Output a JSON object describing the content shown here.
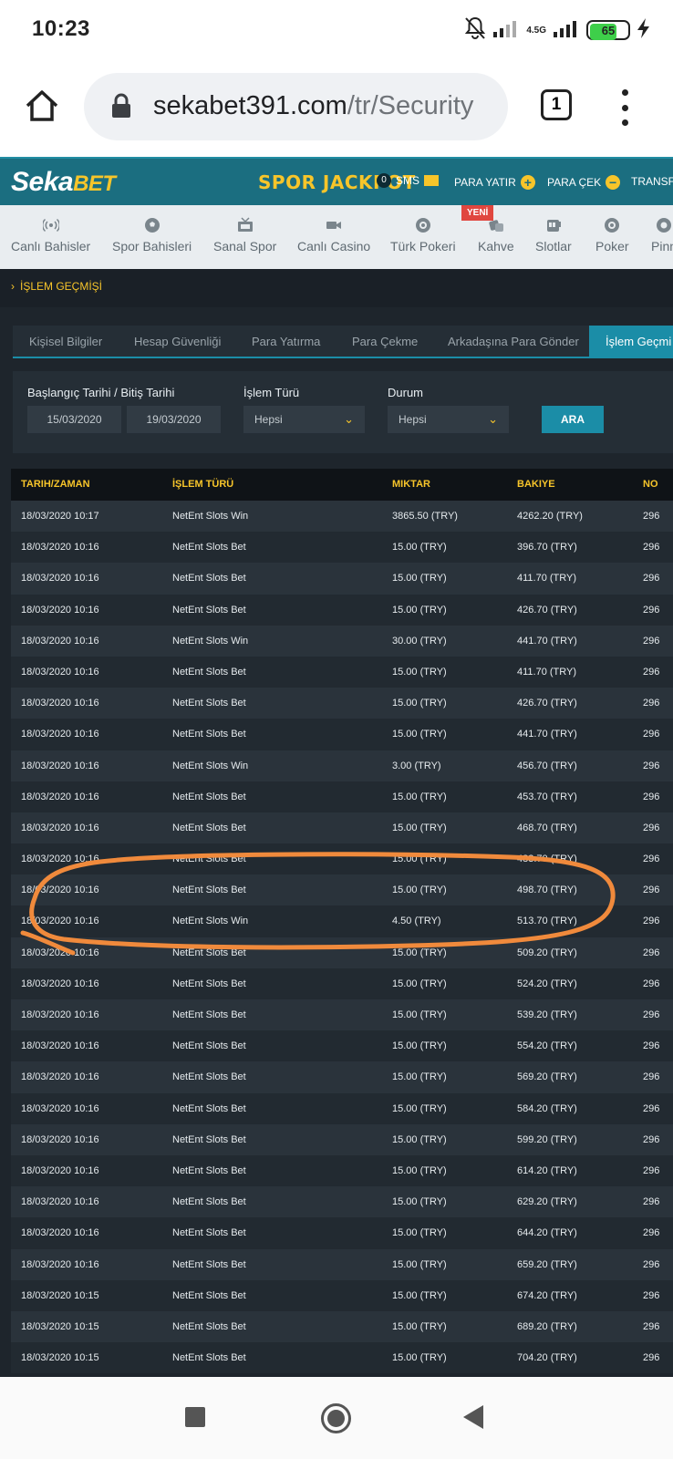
{
  "status_bar": {
    "time": "10:23",
    "network": "4.5G",
    "battery": "65"
  },
  "browser": {
    "url_host": "sekabet391.com",
    "url_path": "/tr/Security",
    "tab_count": "1"
  },
  "site_header": {
    "logo_main": "Seka",
    "logo_accent": "BET",
    "jackpot": "SPOR JACKPOT",
    "sms_count": "0",
    "sms_label": "SMS",
    "deposit_label": "PARA YATIR",
    "withdraw_label": "PARA ÇEK",
    "transfer_label": "TRANSFE"
  },
  "nav": {
    "badge": "YENİ",
    "items": [
      {
        "label": "Canlı Bahisler",
        "icon": "broadcast-icon"
      },
      {
        "label": "Spor Bahisleri",
        "icon": "soccer-ball-icon"
      },
      {
        "label": "Sanal Spor",
        "icon": "tv-icon"
      },
      {
        "label": "Canlı Casino",
        "icon": "camera-icon"
      },
      {
        "label": "Türk Pokeri",
        "icon": "poker-chip-icon"
      },
      {
        "label": "Kahve",
        "icon": "dice-icon"
      },
      {
        "label": "Slotlar",
        "icon": "slot-machine-icon"
      },
      {
        "label": "Poker",
        "icon": "poker-chip-icon"
      },
      {
        "label": "Pinn",
        "icon": "pinnacle-icon"
      }
    ]
  },
  "page": {
    "breadcrumb": "İŞLEM GEÇMİŞİ",
    "tabs": [
      "Kişisel Bilgiler",
      "Hesap Güvenliği",
      "Para Yatırma",
      "Para Çekme",
      "Arkadaşına Para Gönder",
      "İşlem Geçmi"
    ],
    "filters": {
      "date_label": "Başlangıç Tarihi / Bitiş Tarihi",
      "start_date": "15/03/2020",
      "end_date": "19/03/2020",
      "type_label": "İşlem Türü",
      "type_value": "Hepsi",
      "status_label": "Durum",
      "status_value": "Hepsi",
      "search_button": "ARA"
    },
    "table": {
      "headers": [
        "TARIH/ZAMAN",
        "İŞLEM TÜRÜ",
        "MIKTAR",
        "BAKIYE",
        "NO"
      ],
      "rows": [
        [
          "18/03/2020 10:17",
          "NetEnt Slots Win",
          "3865.50 (TRY)",
          "4262.20 (TRY)",
          "296"
        ],
        [
          "18/03/2020 10:16",
          "NetEnt Slots Bet",
          "15.00 (TRY)",
          "396.70 (TRY)",
          "296"
        ],
        [
          "18/03/2020 10:16",
          "NetEnt Slots Bet",
          "15.00 (TRY)",
          "411.70 (TRY)",
          "296"
        ],
        [
          "18/03/2020 10:16",
          "NetEnt Slots Bet",
          "15.00 (TRY)",
          "426.70 (TRY)",
          "296"
        ],
        [
          "18/03/2020 10:16",
          "NetEnt Slots Win",
          "30.00 (TRY)",
          "441.70 (TRY)",
          "296"
        ],
        [
          "18/03/2020 10:16",
          "NetEnt Slots Bet",
          "15.00 (TRY)",
          "411.70 (TRY)",
          "296"
        ],
        [
          "18/03/2020 10:16",
          "NetEnt Slots Bet",
          "15.00 (TRY)",
          "426.70 (TRY)",
          "296"
        ],
        [
          "18/03/2020 10:16",
          "NetEnt Slots Bet",
          "15.00 (TRY)",
          "441.70 (TRY)",
          "296"
        ],
        [
          "18/03/2020 10:16",
          "NetEnt Slots Win",
          "3.00 (TRY)",
          "456.70 (TRY)",
          "296"
        ],
        [
          "18/03/2020 10:16",
          "NetEnt Slots Bet",
          "15.00 (TRY)",
          "453.70 (TRY)",
          "296"
        ],
        [
          "18/03/2020 10:16",
          "NetEnt Slots Bet",
          "15.00 (TRY)",
          "468.70 (TRY)",
          "296"
        ],
        [
          "18/03/2020 10:16",
          "NetEnt Slots Bet",
          "15.00 (TRY)",
          "483.70 (TRY)",
          "296"
        ],
        [
          "18/03/2020 10:16",
          "NetEnt Slots Bet",
          "15.00 (TRY)",
          "498.70 (TRY)",
          "296"
        ],
        [
          "18/03/2020 10:16",
          "NetEnt Slots Win",
          "4.50 (TRY)",
          "513.70 (TRY)",
          "296"
        ],
        [
          "18/03/2020 10:16",
          "NetEnt Slots Bet",
          "15.00 (TRY)",
          "509.20 (TRY)",
          "296"
        ],
        [
          "18/03/2020 10:16",
          "NetEnt Slots Bet",
          "15.00 (TRY)",
          "524.20 (TRY)",
          "296"
        ],
        [
          "18/03/2020 10:16",
          "NetEnt Slots Bet",
          "15.00 (TRY)",
          "539.20 (TRY)",
          "296"
        ],
        [
          "18/03/2020 10:16",
          "NetEnt Slots Bet",
          "15.00 (TRY)",
          "554.20 (TRY)",
          "296"
        ],
        [
          "18/03/2020 10:16",
          "NetEnt Slots Bet",
          "15.00 (TRY)",
          "569.20 (TRY)",
          "296"
        ],
        [
          "18/03/2020 10:16",
          "NetEnt Slots Bet",
          "15.00 (TRY)",
          "584.20 (TRY)",
          "296"
        ],
        [
          "18/03/2020 10:16",
          "NetEnt Slots Bet",
          "15.00 (TRY)",
          "599.20 (TRY)",
          "296"
        ],
        [
          "18/03/2020 10:16",
          "NetEnt Slots Bet",
          "15.00 (TRY)",
          "614.20 (TRY)",
          "296"
        ],
        [
          "18/03/2020 10:16",
          "NetEnt Slots Bet",
          "15.00 (TRY)",
          "629.20 (TRY)",
          "296"
        ],
        [
          "18/03/2020 10:16",
          "NetEnt Slots Bet",
          "15.00 (TRY)",
          "644.20 (TRY)",
          "296"
        ],
        [
          "18/03/2020 10:16",
          "NetEnt Slots Bet",
          "15.00 (TRY)",
          "659.20 (TRY)",
          "296"
        ],
        [
          "18/03/2020 10:15",
          "NetEnt Slots Bet",
          "15.00 (TRY)",
          "674.20 (TRY)",
          "296"
        ],
        [
          "18/03/2020 10:15",
          "NetEnt Slots Bet",
          "15.00 (TRY)",
          "689.20 (TRY)",
          "296"
        ],
        [
          "18/03/2020 10:15",
          "NetEnt Slots Bet",
          "15.00 (TRY)",
          "704.20 (TRY)",
          "296"
        ]
      ]
    }
  },
  "colors": {
    "header_teal": "#1b6e80",
    "accent_yellow": "#f7c52a",
    "active_tab": "#1b8da7",
    "annotation_orange": "#f08a3c"
  }
}
